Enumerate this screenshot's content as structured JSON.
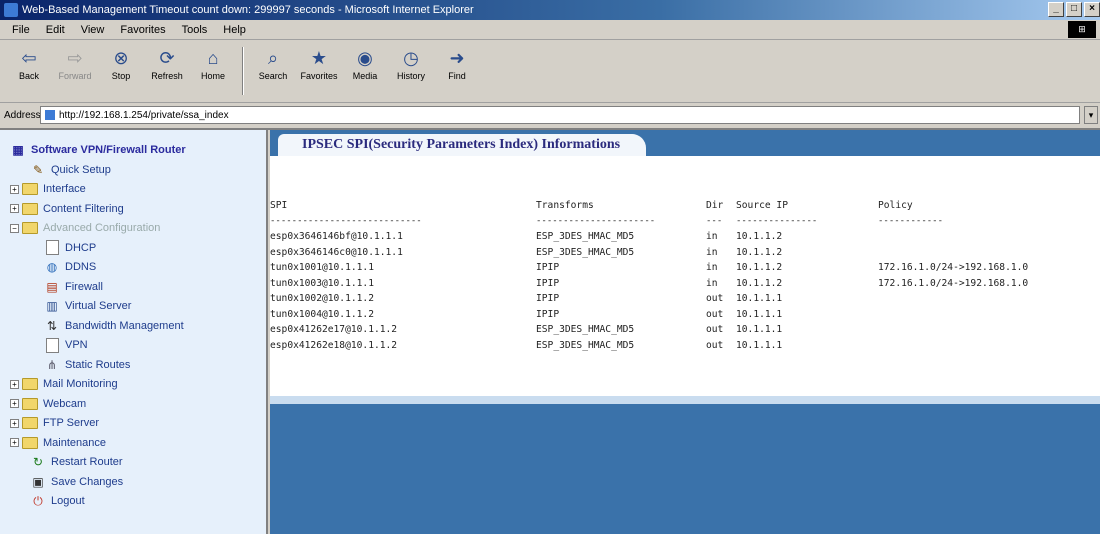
{
  "window": {
    "title": "Web-Based Management Timeout count down: 299997 seconds - Microsoft Internet Explorer",
    "minimize": "_",
    "maximize": "□",
    "close": "×"
  },
  "menu": [
    "File",
    "Edit",
    "View",
    "Favorites",
    "Tools",
    "Help"
  ],
  "toolbar": [
    {
      "label": "Back",
      "icon": "back-arrow-icon",
      "glyph": "⇦"
    },
    {
      "label": "Forward",
      "icon": "forward-arrow-icon",
      "glyph": "⇨"
    },
    {
      "label": "Stop",
      "icon": "stop-icon",
      "glyph": "⊗"
    },
    {
      "label": "Refresh",
      "icon": "refresh-icon",
      "glyph": "⟳"
    },
    {
      "label": "Home",
      "icon": "home-icon",
      "glyph": "⌂"
    },
    {
      "label": "Search",
      "icon": "search-icon",
      "glyph": "⌕"
    },
    {
      "label": "Favorites",
      "icon": "favorites-icon",
      "glyph": "★"
    },
    {
      "label": "Media",
      "icon": "media-icon",
      "glyph": "◉"
    },
    {
      "label": "History",
      "icon": "history-icon",
      "glyph": "◷"
    },
    {
      "label": "Find",
      "icon": "find-icon",
      "glyph": "➜"
    }
  ],
  "address": {
    "label": "Address",
    "url": "http://192.168.1.254/private/ssa_index"
  },
  "sidebar": {
    "root": "Software VPN/Firewall Router",
    "items": [
      {
        "label": "Quick Setup"
      },
      {
        "label": "Interface"
      },
      {
        "label": "Content Filtering"
      },
      {
        "label": "Advanced Configuration"
      },
      {
        "label": "DHCP"
      },
      {
        "label": "DDNS"
      },
      {
        "label": "Firewall"
      },
      {
        "label": "Virtual Server"
      },
      {
        "label": "Bandwidth Management"
      },
      {
        "label": "VPN"
      },
      {
        "label": "Static Routes"
      },
      {
        "label": "Mail Monitoring"
      },
      {
        "label": "Webcam"
      },
      {
        "label": "FTP Server"
      },
      {
        "label": "Maintenance"
      },
      {
        "label": "Restart Router"
      },
      {
        "label": "Save Changes"
      },
      {
        "label": "Logout"
      }
    ]
  },
  "main": {
    "tab_title": "IPSEC SPI(Security Parameters Index) Informations",
    "headers": {
      "spi": "SPI",
      "transforms": "Transforms",
      "dir": "Dir",
      "source_ip": "Source IP",
      "policy": "Policy"
    },
    "dashes": {
      "spi": "----------------------------",
      "transforms": "----------------------",
      "dir": "---",
      "source_ip": "---------------",
      "policy": "------------"
    },
    "rows": [
      {
        "spi": "esp0x3646146bf@10.1.1.1",
        "transforms": "ESP_3DES_HMAC_MD5",
        "dir": "in",
        "source_ip": "10.1.1.2",
        "policy": ""
      },
      {
        "spi": "esp0x3646146c0@10.1.1.1",
        "transforms": "ESP_3DES_HMAC_MD5",
        "dir": "in",
        "source_ip": "10.1.1.2",
        "policy": ""
      },
      {
        "spi": "tun0x1001@10.1.1.1",
        "transforms": "IPIP",
        "dir": "in",
        "source_ip": "10.1.1.2",
        "policy": "172.16.1.0/24->192.168.1.0"
      },
      {
        "spi": "tun0x1003@10.1.1.1",
        "transforms": "IPIP",
        "dir": "in",
        "source_ip": "10.1.1.2",
        "policy": "172.16.1.0/24->192.168.1.0"
      },
      {
        "spi": "tun0x1002@10.1.1.2",
        "transforms": "IPIP",
        "dir": "out",
        "source_ip": "10.1.1.1",
        "policy": ""
      },
      {
        "spi": "tun0x1004@10.1.1.2",
        "transforms": "IPIP",
        "dir": "out",
        "source_ip": "10.1.1.1",
        "policy": ""
      },
      {
        "spi": "esp0x41262e17@10.1.1.2",
        "transforms": "ESP_3DES_HMAC_MD5",
        "dir": "out",
        "source_ip": "10.1.1.1",
        "policy": ""
      },
      {
        "spi": "esp0x41262e18@10.1.1.2",
        "transforms": "ESP_3DES_HMAC_MD5",
        "dir": "out",
        "source_ip": "10.1.1.1",
        "policy": ""
      }
    ]
  }
}
